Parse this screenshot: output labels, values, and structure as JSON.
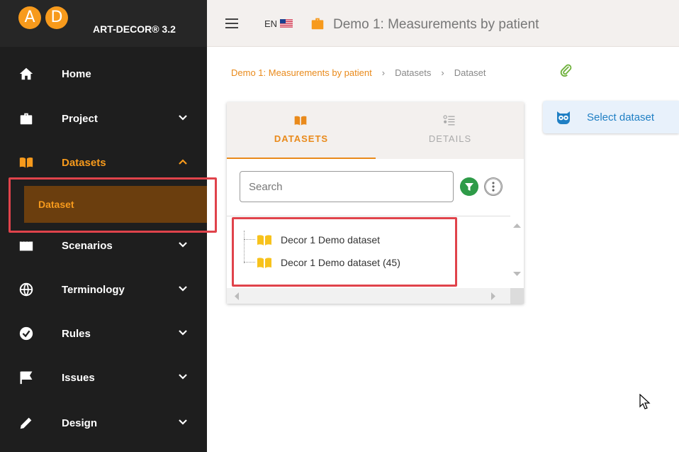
{
  "brand": {
    "logo_a": "A",
    "logo_d": "D",
    "title": "ART-DECOR® 3.2"
  },
  "sidebar": {
    "items": [
      {
        "label": "Home",
        "icon": "home-icon"
      },
      {
        "label": "Project",
        "icon": "briefcase-icon"
      },
      {
        "label": "Datasets",
        "icon": "book-icon"
      },
      {
        "label": "Scenarios",
        "icon": "clapper-icon"
      },
      {
        "label": "Terminology",
        "icon": "globe-icon"
      },
      {
        "label": "Rules",
        "icon": "check-circle-icon"
      },
      {
        "label": "Issues",
        "icon": "flag-icon"
      },
      {
        "label": "Design",
        "icon": "pencil-icon"
      }
    ],
    "sub_item": "Dataset"
  },
  "topbar": {
    "lang": "EN",
    "title": "Demo 1: Measurements by patient"
  },
  "breadcrumb": {
    "project": "Demo 1: Measurements by patient",
    "section": "Datasets",
    "current": "Dataset"
  },
  "panel": {
    "tab_datasets": "DATASETS",
    "tab_details": "DETAILS",
    "search_placeholder": "Search",
    "tree": [
      {
        "label": "Decor 1 Demo dataset"
      },
      {
        "label": "Decor 1 Demo dataset (45)"
      }
    ]
  },
  "select_button": {
    "label": "Select dataset"
  },
  "colors": {
    "accent": "#f79a1c",
    "highlight": "#e0434b",
    "sidebar_bg": "#1e1e1e",
    "link_blue": "#1f7fc4"
  }
}
